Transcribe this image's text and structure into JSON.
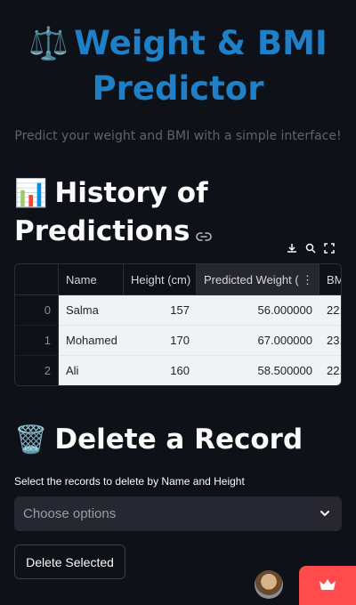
{
  "header": {
    "emoji": "⚖️",
    "title_line1": "Weight & BMI",
    "title_line2": "Predictor",
    "subtitle": "Predict your weight and BMI with a simple interface!"
  },
  "history": {
    "emoji": "📊",
    "heading_line1": "History of",
    "heading_line2": "Predictions",
    "columns": [
      "Name",
      "Height (cm)",
      "Predicted Weight (",
      "BM"
    ],
    "rows": [
      {
        "index": "0",
        "name": "Salma",
        "height": "157",
        "weight": "56.000000",
        "bmi": "22."
      },
      {
        "index": "1",
        "name": "Mohamed",
        "height": "170",
        "weight": "67.000000",
        "bmi": "23."
      },
      {
        "index": "2",
        "name": "Ali",
        "height": "160",
        "weight": "58.500000",
        "bmi": "22."
      }
    ]
  },
  "delete": {
    "emoji": "🗑️",
    "heading": "Delete a Record",
    "label": "Select the records to delete by Name and Height",
    "placeholder": "Choose options",
    "button_label": "Delete Selected"
  },
  "colors": {
    "accent": "#1f7fc7",
    "background": "#0e1117",
    "badge": "#ff4b4b"
  }
}
